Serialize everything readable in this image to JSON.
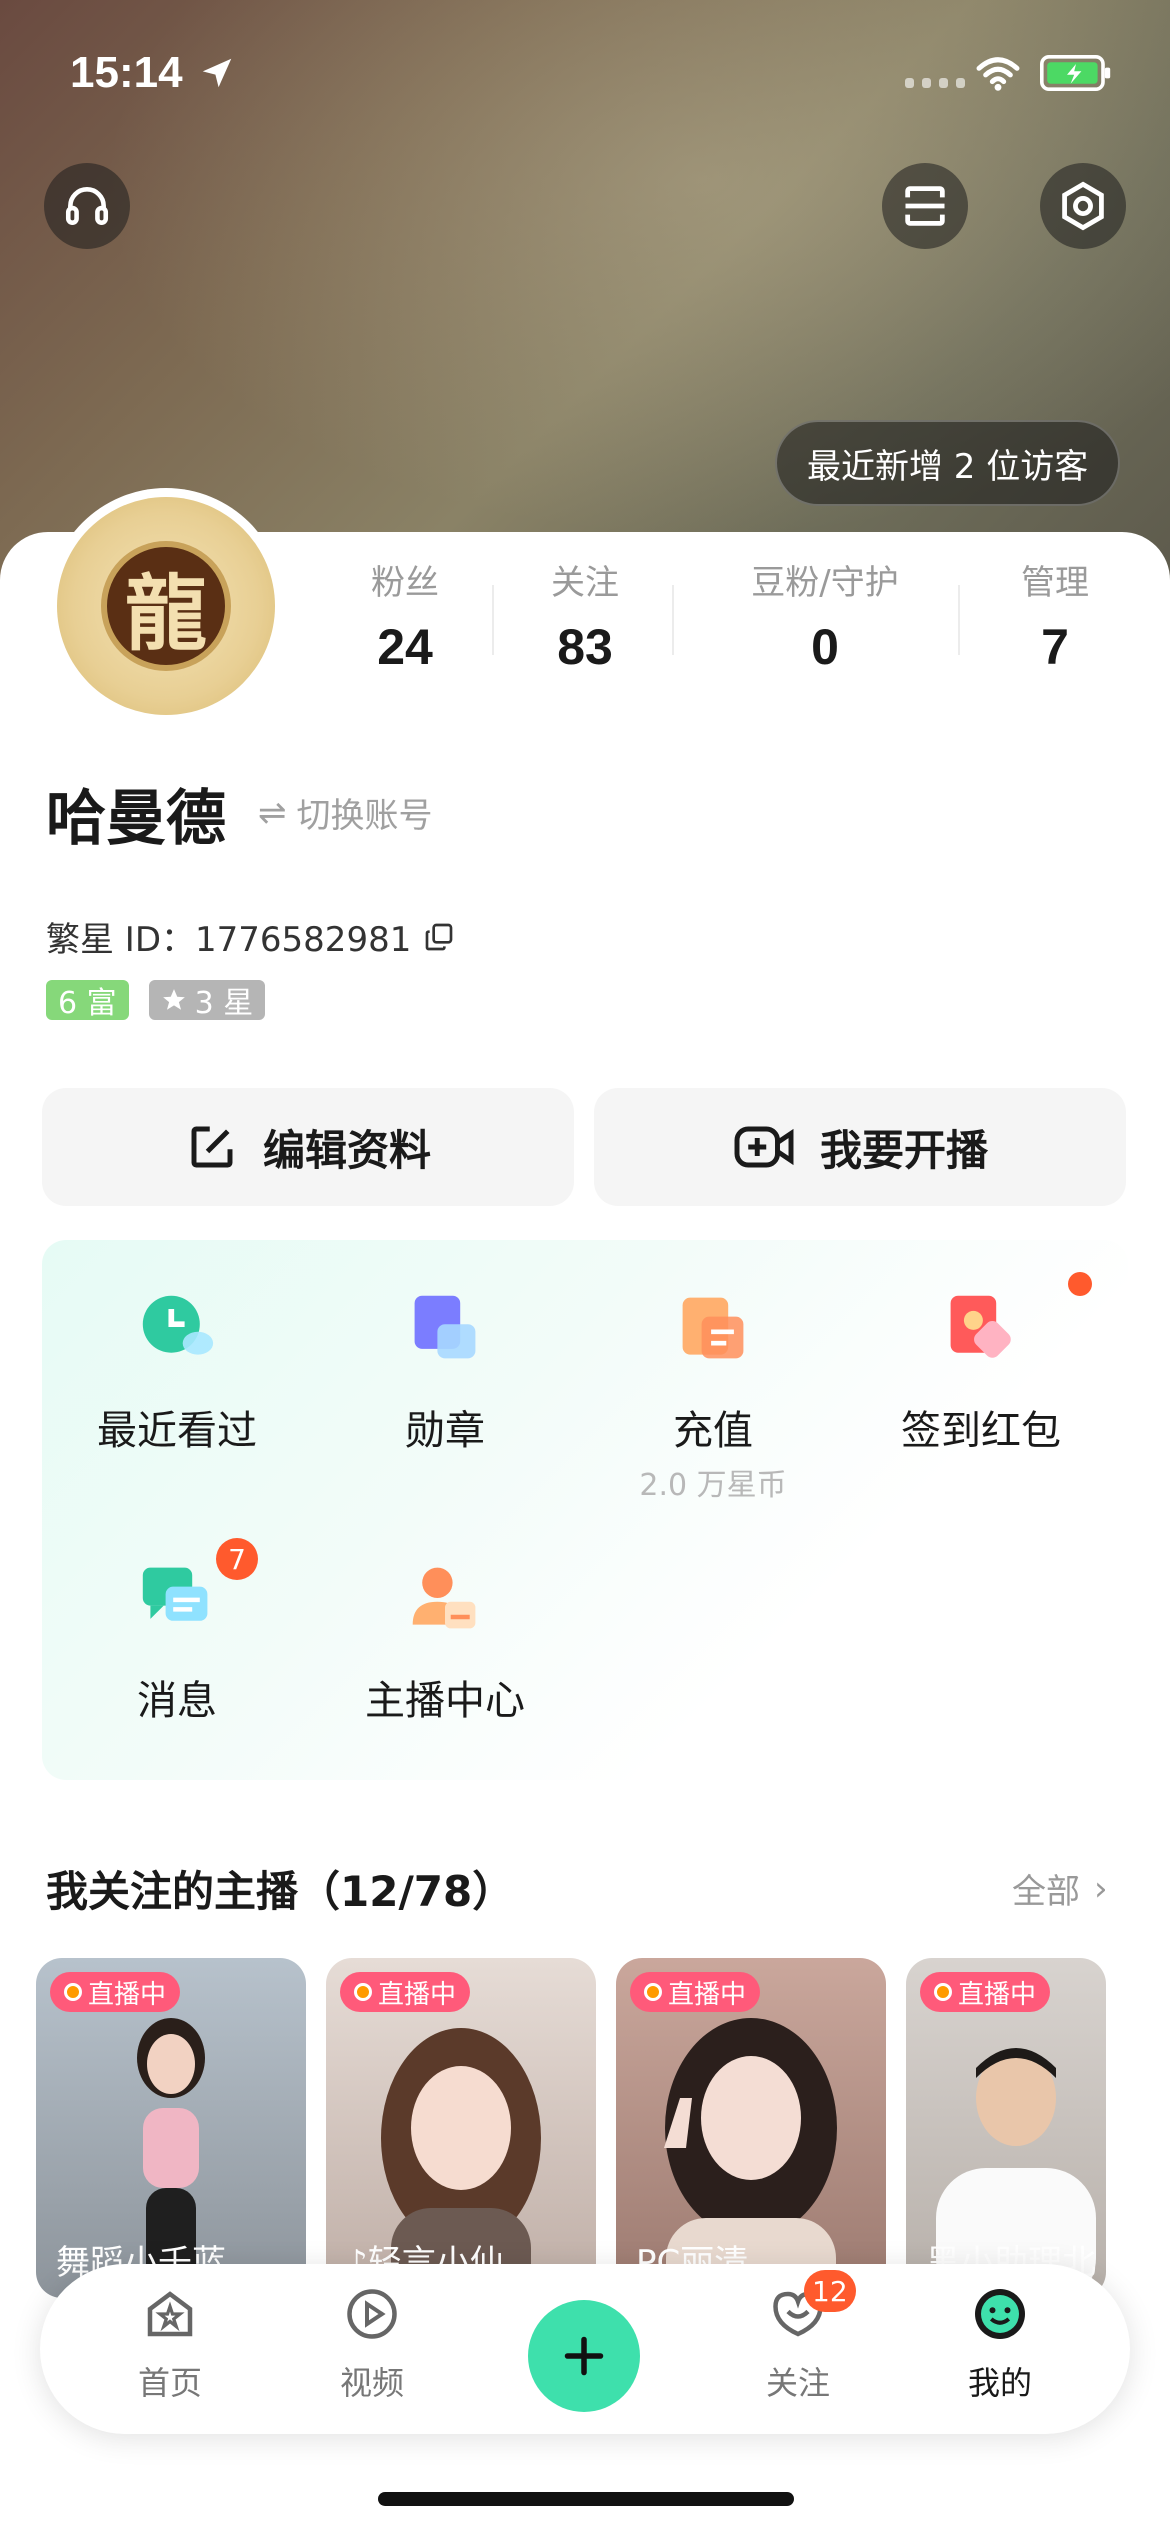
{
  "status_bar": {
    "time": "15:14"
  },
  "header": {
    "visitor_notice": "最近新增 2 位访客"
  },
  "stats": [
    {
      "label": "粉丝",
      "value": "24"
    },
    {
      "label": "关注",
      "value": "83"
    },
    {
      "label": "豆粉/守护",
      "value": "0"
    },
    {
      "label": "管理",
      "value": "7"
    }
  ],
  "avatar": {
    "glyph": "龍"
  },
  "profile": {
    "username": "哈曼德",
    "switch_account": "切换账号",
    "id_text": "繁星 ID：1776582981",
    "badge_rich": "6 富",
    "badge_star": "3 星"
  },
  "actions": {
    "edit": "编辑资料",
    "live": "我要开播"
  },
  "grid": [
    {
      "label": "最近看过",
      "sub": ""
    },
    {
      "label": "勋章",
      "sub": ""
    },
    {
      "label": "充值",
      "sub": "2.0 万星币"
    },
    {
      "label": "签到红包",
      "sub": ""
    },
    {
      "label": "消息",
      "sub": "",
      "badge": "7"
    },
    {
      "label": "主播中心",
      "sub": ""
    }
  ],
  "following": {
    "title": "我关注的主播（12/78）",
    "more": "全部",
    "live_label": "直播中",
    "streamers": [
      {
        "name": "舞蹈小千蓝",
        "bg": "#cbd3dc"
      },
      {
        "name": "♪轻言小仙",
        "bg": "#dcc9c4"
      },
      {
        "name": "PC丽清",
        "bg": "#c9a99f"
      },
      {
        "name": "黑小助理北",
        "bg": "#d7d3cf"
      }
    ]
  },
  "tabbar": {
    "home": "首页",
    "video": "视频",
    "follow": "关注",
    "follow_badge": "12",
    "mine": "我的"
  },
  "colors": {
    "accent": "#3ee0ac",
    "badge_red": "#ff5a2d",
    "live_pink": "#ff5a7a"
  }
}
